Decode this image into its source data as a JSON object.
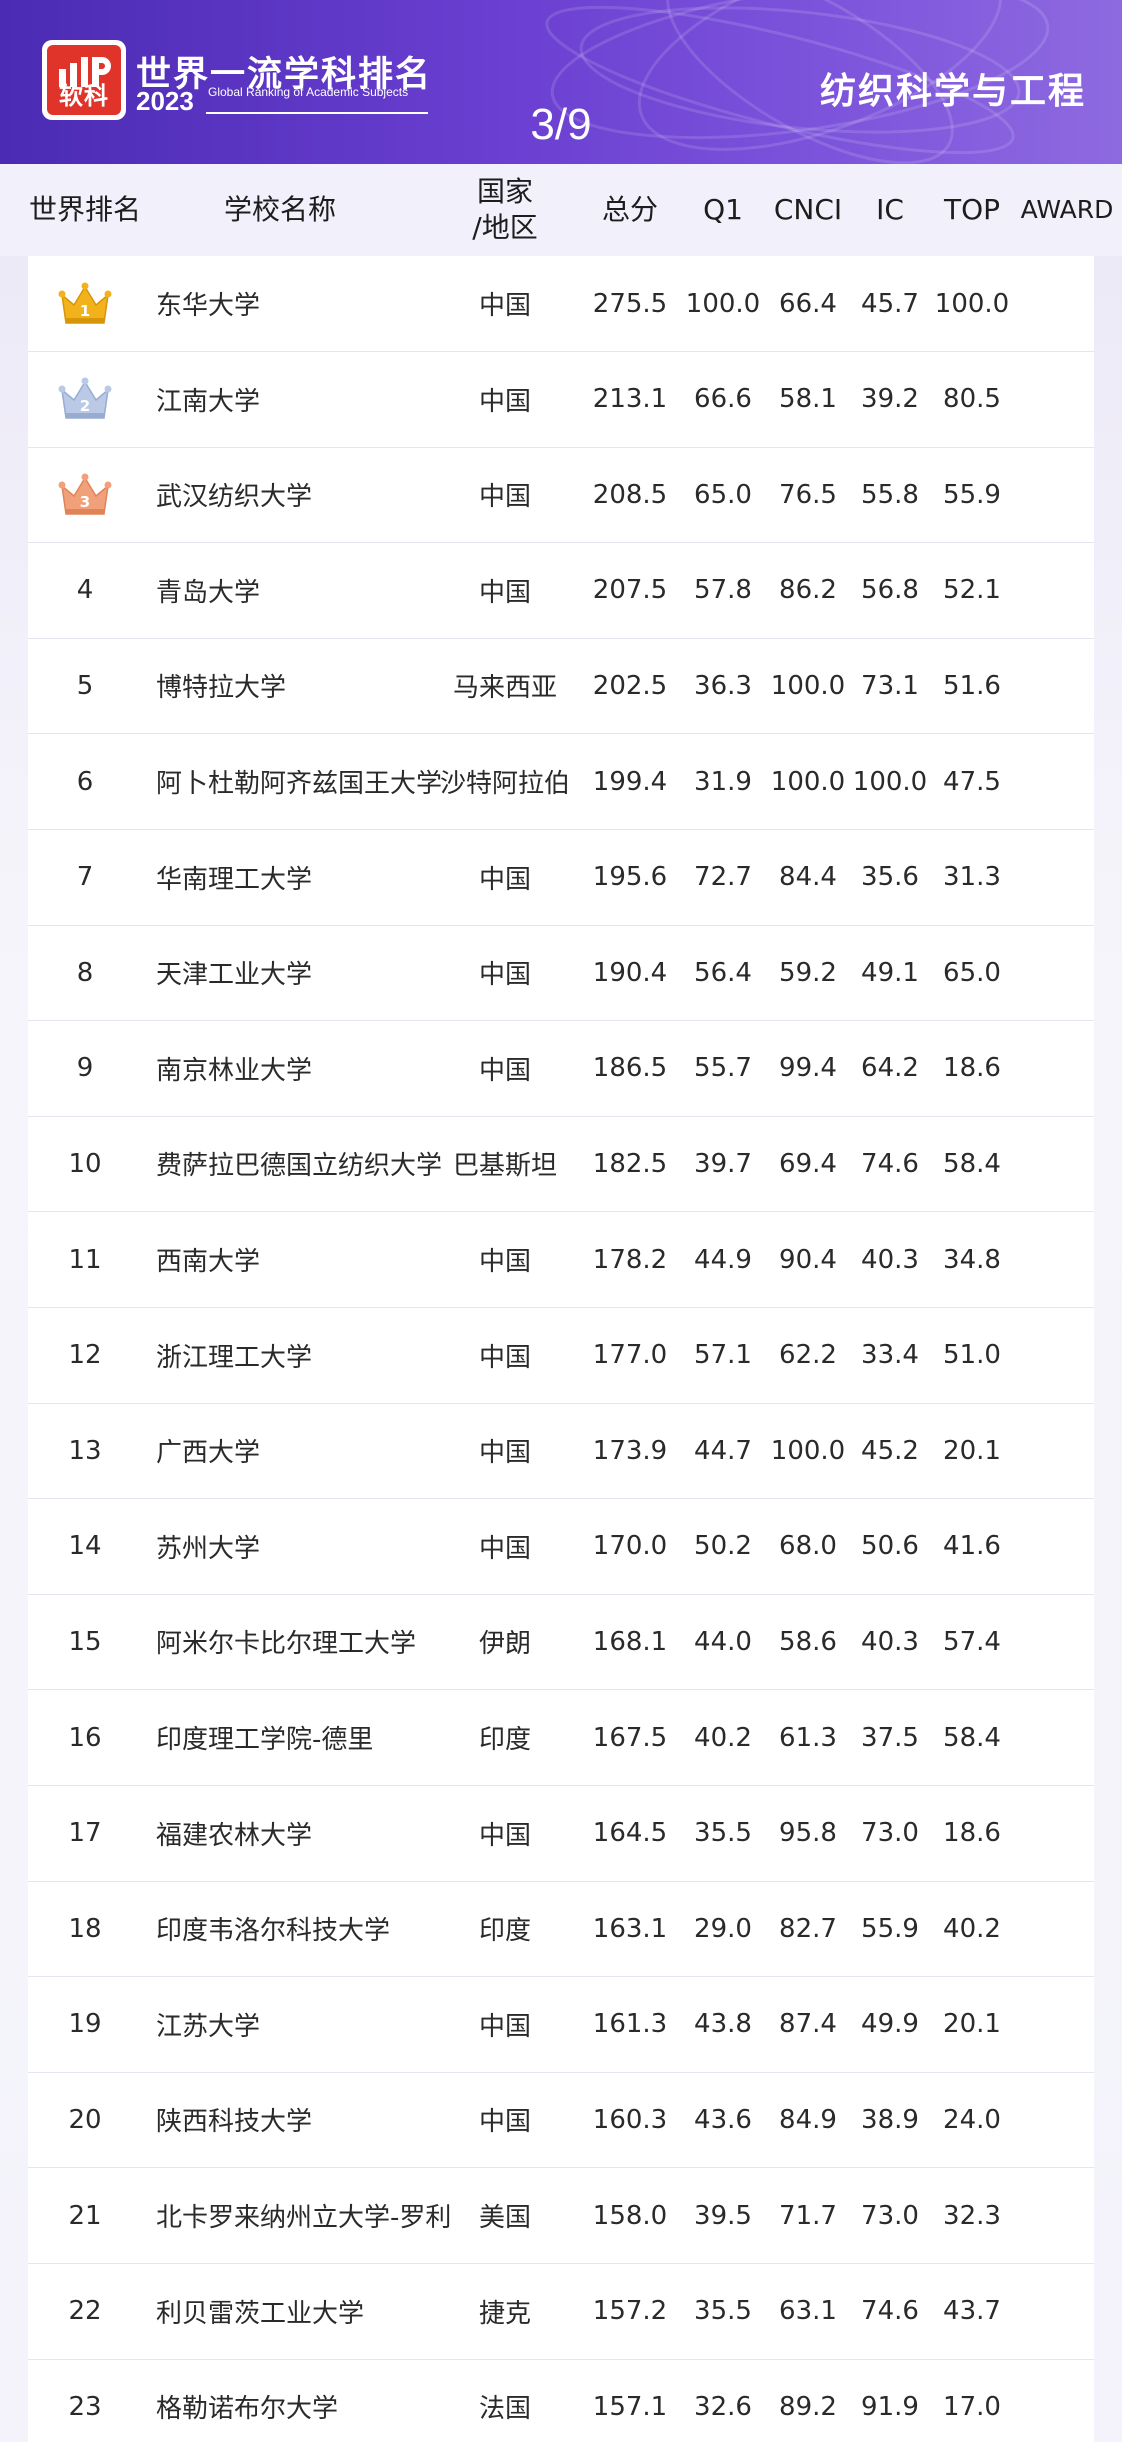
{
  "header": {
    "logo_text": "软科",
    "brand_title": "世界一流学科排名",
    "brand_year": "2023",
    "brand_subtitle": "Global Ranking of Academic Subjects",
    "subject": "纺织科学与工程",
    "page_indicator": "3/9"
  },
  "colors": {
    "banner_start": "#4b2bb3",
    "banner_end": "#8e6ae0",
    "logo_red": "#e0342b",
    "gold": "#f2b21c",
    "silver": "#b9c9e6",
    "bronze": "#f1a17a"
  },
  "table": {
    "columns": [
      {
        "key": "rank",
        "label": "世界排名"
      },
      {
        "key": "name",
        "label": "学校名称"
      },
      {
        "key": "region",
        "label": "国家\n/地区"
      },
      {
        "key": "total",
        "label": "总分"
      },
      {
        "key": "q1",
        "label": "Q1"
      },
      {
        "key": "cnci",
        "label": "CNCI"
      },
      {
        "key": "ic",
        "label": "IC"
      },
      {
        "key": "top",
        "label": "TOP"
      },
      {
        "key": "award",
        "label": "AWARD"
      }
    ],
    "rows": [
      {
        "rank": "1",
        "medal": "gold",
        "name": "东华大学",
        "region": "中国",
        "total": "275.5",
        "q1": "100.0",
        "cnci": "66.4",
        "ic": "45.7",
        "top": "100.0",
        "award": ""
      },
      {
        "rank": "2",
        "medal": "silver",
        "name": "江南大学",
        "region": "中国",
        "total": "213.1",
        "q1": "66.6",
        "cnci": "58.1",
        "ic": "39.2",
        "top": "80.5",
        "award": ""
      },
      {
        "rank": "3",
        "medal": "bronze",
        "name": "武汉纺织大学",
        "region": "中国",
        "total": "208.5",
        "q1": "65.0",
        "cnci": "76.5",
        "ic": "55.8",
        "top": "55.9",
        "award": ""
      },
      {
        "rank": "4",
        "medal": "",
        "name": "青岛大学",
        "region": "中国",
        "total": "207.5",
        "q1": "57.8",
        "cnci": "86.2",
        "ic": "56.8",
        "top": "52.1",
        "award": ""
      },
      {
        "rank": "5",
        "medal": "",
        "name": "博特拉大学",
        "region": "马来西亚",
        "total": "202.5",
        "q1": "36.3",
        "cnci": "100.0",
        "ic": "73.1",
        "top": "51.6",
        "award": ""
      },
      {
        "rank": "6",
        "medal": "",
        "name": "阿卜杜勒阿齐兹国王大学",
        "region": "沙特阿拉伯",
        "total": "199.4",
        "q1": "31.9",
        "cnci": "100.0",
        "ic": "100.0",
        "top": "47.5",
        "award": ""
      },
      {
        "rank": "7",
        "medal": "",
        "name": "华南理工大学",
        "region": "中国",
        "total": "195.6",
        "q1": "72.7",
        "cnci": "84.4",
        "ic": "35.6",
        "top": "31.3",
        "award": ""
      },
      {
        "rank": "8",
        "medal": "",
        "name": "天津工业大学",
        "region": "中国",
        "total": "190.4",
        "q1": "56.4",
        "cnci": "59.2",
        "ic": "49.1",
        "top": "65.0",
        "award": ""
      },
      {
        "rank": "9",
        "medal": "",
        "name": "南京林业大学",
        "region": "中国",
        "total": "186.5",
        "q1": "55.7",
        "cnci": "99.4",
        "ic": "64.2",
        "top": "18.6",
        "award": ""
      },
      {
        "rank": "10",
        "medal": "",
        "name": "费萨拉巴德国立纺织大学",
        "region": "巴基斯坦",
        "total": "182.5",
        "q1": "39.7",
        "cnci": "69.4",
        "ic": "74.6",
        "top": "58.4",
        "award": ""
      },
      {
        "rank": "11",
        "medal": "",
        "name": "西南大学",
        "region": "中国",
        "total": "178.2",
        "q1": "44.9",
        "cnci": "90.4",
        "ic": "40.3",
        "top": "34.8",
        "award": ""
      },
      {
        "rank": "12",
        "medal": "",
        "name": "浙江理工大学",
        "region": "中国",
        "total": "177.0",
        "q1": "57.1",
        "cnci": "62.2",
        "ic": "33.4",
        "top": "51.0",
        "award": ""
      },
      {
        "rank": "13",
        "medal": "",
        "name": "广西大学",
        "region": "中国",
        "total": "173.9",
        "q1": "44.7",
        "cnci": "100.0",
        "ic": "45.2",
        "top": "20.1",
        "award": ""
      },
      {
        "rank": "14",
        "medal": "",
        "name": "苏州大学",
        "region": "中国",
        "total": "170.0",
        "q1": "50.2",
        "cnci": "68.0",
        "ic": "50.6",
        "top": "41.6",
        "award": ""
      },
      {
        "rank": "15",
        "medal": "",
        "name": "阿米尔卡比尔理工大学",
        "region": "伊朗",
        "total": "168.1",
        "q1": "44.0",
        "cnci": "58.6",
        "ic": "40.3",
        "top": "57.4",
        "award": ""
      },
      {
        "rank": "16",
        "medal": "",
        "name": "印度理工学院-德里",
        "region": "印度",
        "total": "167.5",
        "q1": "40.2",
        "cnci": "61.3",
        "ic": "37.5",
        "top": "58.4",
        "award": ""
      },
      {
        "rank": "17",
        "medal": "",
        "name": "福建农林大学",
        "region": "中国",
        "total": "164.5",
        "q1": "35.5",
        "cnci": "95.8",
        "ic": "73.0",
        "top": "18.6",
        "award": ""
      },
      {
        "rank": "18",
        "medal": "",
        "name": "印度韦洛尔科技大学",
        "region": "印度",
        "total": "163.1",
        "q1": "29.0",
        "cnci": "82.7",
        "ic": "55.9",
        "top": "40.2",
        "award": ""
      },
      {
        "rank": "19",
        "medal": "",
        "name": "江苏大学",
        "region": "中国",
        "total": "161.3",
        "q1": "43.8",
        "cnci": "87.4",
        "ic": "49.9",
        "top": "20.1",
        "award": ""
      },
      {
        "rank": "20",
        "medal": "",
        "name": "陕西科技大学",
        "region": "中国",
        "total": "160.3",
        "q1": "43.6",
        "cnci": "84.9",
        "ic": "38.9",
        "top": "24.0",
        "award": ""
      },
      {
        "rank": "21",
        "medal": "",
        "name": "北卡罗来纳州立大学-罗利",
        "region": "美国",
        "total": "158.0",
        "q1": "39.5",
        "cnci": "71.7",
        "ic": "73.0",
        "top": "32.3",
        "award": ""
      },
      {
        "rank": "22",
        "medal": "",
        "name": "利贝雷茨工业大学",
        "region": "捷克",
        "total": "157.2",
        "q1": "35.5",
        "cnci": "63.1",
        "ic": "74.6",
        "top": "43.7",
        "award": ""
      },
      {
        "rank": "23",
        "medal": "",
        "name": "格勒诺布尔大学",
        "region": "法国",
        "total": "157.1",
        "q1": "32.6",
        "cnci": "89.2",
        "ic": "91.9",
        "top": "17.0",
        "award": ""
      }
    ]
  }
}
